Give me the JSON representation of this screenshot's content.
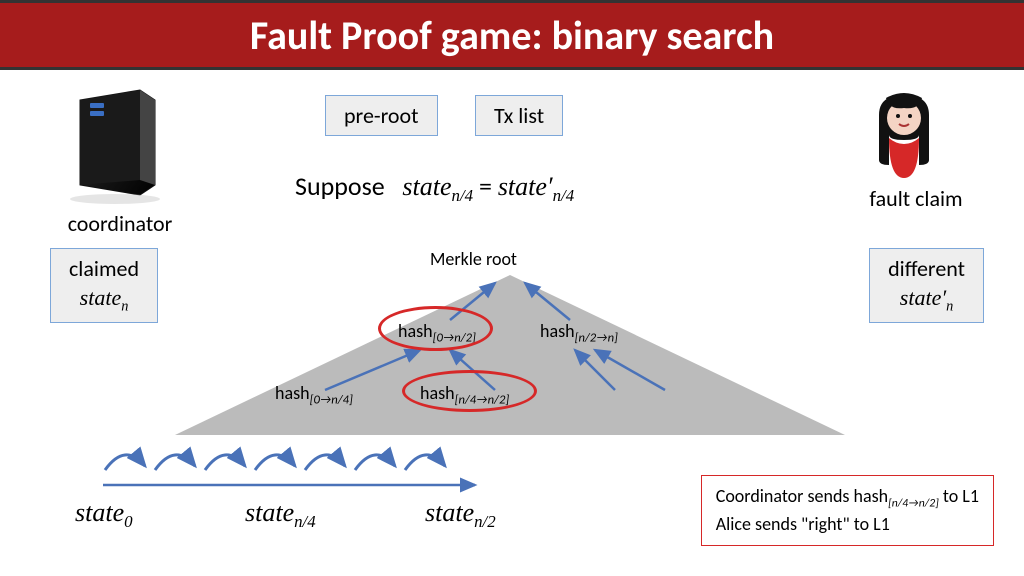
{
  "title": "Fault Proof game: binary search",
  "boxes": {
    "preroot": "pre-root",
    "txlist": "Tx list",
    "claimed_label": "claimed",
    "claimed_state": "state",
    "claimed_sub": "n",
    "different_label": "different",
    "different_state": "state′",
    "different_sub": "n"
  },
  "labels": {
    "coordinator": "coordinator",
    "fault_claim": "fault claim",
    "suppose": "Suppose",
    "merkle_root": "Merkle root"
  },
  "equation": {
    "lhs": "state",
    "lhs_sub": "n/4",
    "eq": " = ",
    "rhs": "state′",
    "rhs_sub": "n/4"
  },
  "tree": {
    "hash1": "hash",
    "hash1_sub": "[0→n/2]",
    "hash2": "hash",
    "hash2_sub": "[n/2→n]",
    "hash3": "hash",
    "hash3_sub": "[0→n/4]",
    "hash4": "hash",
    "hash4_sub": "[n/4→n/2]"
  },
  "states": {
    "s0": "state",
    "s0_sub": "0",
    "s1": "state",
    "s1_sub": "n/4",
    "s2": "state",
    "s2_sub": "n/2"
  },
  "note": {
    "line1a": "Coordinator sends hash",
    "line1b": "[n/4→n/2]",
    "line1c": " to L1",
    "line2": "Alice sends \"right\" to L1"
  }
}
